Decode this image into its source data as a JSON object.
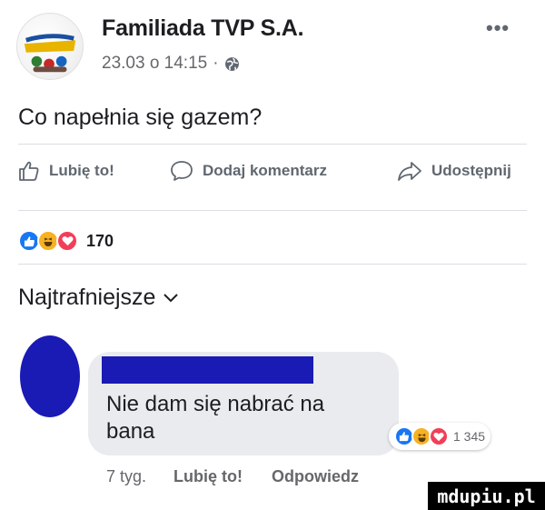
{
  "post": {
    "page_name": "Familiada TVP S.A.",
    "timestamp": "23.03 o 14:15",
    "separator": "·",
    "privacy_icon": "globe-icon",
    "more_icon": "•••",
    "text": "Co napełnia się gazem?"
  },
  "actions": {
    "like_label": "Lubię to!",
    "comment_label": "Dodaj komentarz",
    "share_label": "Udostępnij"
  },
  "reactions": {
    "types": [
      "like",
      "haha",
      "love"
    ],
    "count": "170"
  },
  "comments": {
    "sort_label": "Najtrafniejsze"
  },
  "comment": {
    "text": "Nie dam się nabrać na bana",
    "reactions_count": "1 345",
    "time": "7 tyg.",
    "like_label": "Lubię to!",
    "reply_label": "Odpowiedz"
  },
  "watermark": {
    "text": "mdupiu.pl"
  },
  "colors": {
    "like_blue": "#1877f2",
    "haha_yellow": "#f7b125",
    "love_red": "#f33e58",
    "redaction_blue": "#1a1ab4",
    "bubble_gray": "#e9ebee"
  }
}
